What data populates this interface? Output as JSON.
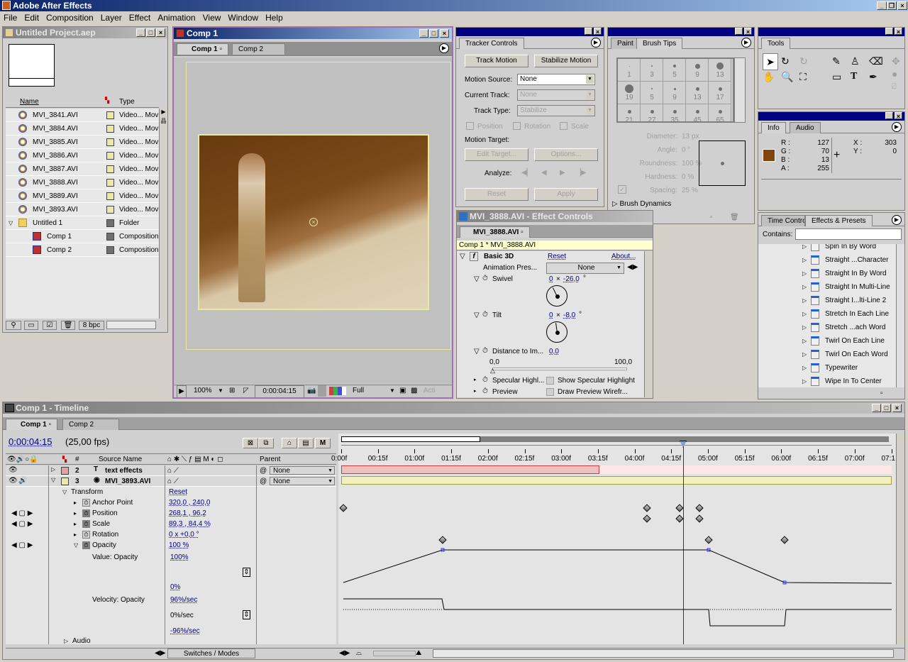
{
  "app": {
    "title": "Adobe After Effects"
  },
  "menu": [
    "File",
    "Edit",
    "Composition",
    "Layer",
    "Effect",
    "Animation",
    "View",
    "Window",
    "Help"
  ],
  "project": {
    "title": "Untitled Project.aep",
    "columns": {
      "name": "Name",
      "type": "Type"
    },
    "items": [
      {
        "name": "MVI_3841.AVI",
        "type": "Video... Movie",
        "label_color": "#ece9a8",
        "indent": 0,
        "icon": "video-file-icon"
      },
      {
        "name": "MVI_3884.AVI",
        "type": "Video... Movie",
        "label_color": "#ece9a8",
        "indent": 0,
        "icon": "video-file-icon"
      },
      {
        "name": "MVI_3885.AVI",
        "type": "Video... Movie",
        "label_color": "#ece9a8",
        "indent": 0,
        "icon": "video-file-icon"
      },
      {
        "name": "MVI_3886.AVI",
        "type": "Video... Movie",
        "label_color": "#ece9a8",
        "indent": 0,
        "icon": "video-file-icon"
      },
      {
        "name": "MVI_3887.AVI",
        "type": "Video... Movie",
        "label_color": "#ece9a8",
        "indent": 0,
        "icon": "video-file-icon"
      },
      {
        "name": "MVI_3888.AVI",
        "type": "Video... Movie",
        "label_color": "#ece9a8",
        "indent": 0,
        "icon": "video-file-icon"
      },
      {
        "name": "MVI_3889.AVI",
        "type": "Video... Movie",
        "label_color": "#ece9a8",
        "indent": 0,
        "icon": "video-file-icon"
      },
      {
        "name": "MVI_3893.AVI",
        "type": "Video... Movie",
        "label_color": "#ece9a8",
        "indent": 0,
        "icon": "video-file-icon"
      },
      {
        "name": "Untitled 1",
        "type": "Folder",
        "label_color": "#707070",
        "indent": 0,
        "icon": "folder-icon",
        "expanded": true
      },
      {
        "name": "Comp 1",
        "type": "Composition",
        "label_color": "#707070",
        "indent": 1,
        "icon": "composition-icon"
      },
      {
        "name": "Comp 2",
        "type": "Composition",
        "label_color": "#707070",
        "indent": 1,
        "icon": "composition-icon"
      }
    ],
    "bpc": "8 bpc"
  },
  "comp_viewer": {
    "title": "Comp 1",
    "tabs": [
      "Comp 1",
      "Comp 2"
    ],
    "zoom": "100%",
    "timecode": "0:00:04:15",
    "resolution": "Full",
    "view": "Acti"
  },
  "tracker": {
    "tab": "Tracker Controls",
    "track_motion": "Track Motion",
    "stabilize_motion": "Stabilize Motion",
    "motion_source_label": "Motion Source:",
    "motion_source": "None",
    "current_track_label": "Current Track:",
    "current_track": "None",
    "track_type_label": "Track Type:",
    "track_type": "Stabilize",
    "position": "Position",
    "rotation": "Rotation",
    "scale": "Scale",
    "motion_target_label": "Motion Target:",
    "edit_target": "Edit Target...",
    "options": "Options...",
    "analyze_label": "Analyze:",
    "reset": "Reset",
    "apply": "Apply"
  },
  "brush": {
    "tabs": [
      "Paint",
      "Brush Tips"
    ],
    "tips": [
      "1",
      "3",
      "5",
      "9",
      "13",
      "19",
      "5",
      "9",
      "13",
      "17",
      "21",
      "27",
      "35",
      "45",
      "65"
    ],
    "diameter_label": "Diameter:",
    "diameter": "13 px",
    "angle_label": "Angle:",
    "angle": "0 °",
    "roundness_label": "Roundness:",
    "roundness": "100 %",
    "hardness_label": "Hardness:",
    "hardness": "0 %",
    "spacing_label": "Spacing:",
    "spacing": "25 %",
    "dynamics": "Brush Dynamics"
  },
  "tools": {
    "tab": "Tools"
  },
  "info": {
    "tabs": [
      "Info",
      "Audio"
    ],
    "r_label": "R :",
    "r": "127",
    "g_label": "G :",
    "g": "70",
    "b_label": "B :",
    "b": "13",
    "a_label": "A :",
    "a": "255",
    "x_label": "X :",
    "x": "303",
    "y_label": "Y :",
    "y": "0",
    "swatch": "#7f460d"
  },
  "effects_presets": {
    "tabs": [
      "Time Contro",
      "Effects & Presets"
    ],
    "contains_label": "Contains:",
    "contains_value": "",
    "items": [
      "Spin In By Word",
      "Straight ...Character",
      "Straight In By Word",
      "Straight In Multi-Line",
      "Straight I...lti-Line 2",
      "Stretch In Each Line",
      "Stretch ...ach Word",
      "Twirl On Each Line",
      "Twirl On Each Word",
      "Typewriter",
      "Wipe In To Center"
    ]
  },
  "effect_controls": {
    "title": "MVI_3888.AVI - Effect Controls",
    "tab": "MVI_3888.AVI",
    "breadcrumb": "Comp 1 * MVI_3888.AVI",
    "effect_name": "Basic 3D",
    "reset": "Reset",
    "about": "About...",
    "anim_preset_label": "Animation Pres...",
    "anim_preset": "None",
    "swivel_label": "Swivel",
    "swivel_rev": "0",
    "swivel_deg": "-26,0",
    "tilt_label": "Tilt",
    "tilt_rev": "0",
    "tilt_deg": "-8,0",
    "distance_label": "Distance to Im...",
    "distance": "0,0",
    "slider_min": "0,0",
    "slider_max": "100,0",
    "specular_label": "Specular Highl...",
    "specular_cb": "Show Specular Highlight",
    "preview_label": "Preview",
    "preview_cb": "Draw Preview Wirefr..."
  },
  "timeline": {
    "title": "Comp 1 - Timeline",
    "tabs": [
      "Comp 1",
      "Comp 2"
    ],
    "timecode": "0:00:04:15",
    "fps": "(25,00 fps)",
    "col_num": "#",
    "col_source": "Source Name",
    "col_parent": "Parent",
    "ruler": [
      "0:00f",
      "00:15f",
      "01:00f",
      "01:15f",
      "02:00f",
      "02:15f",
      "03:00f",
      "03:15f",
      "04:00f",
      "04:15f",
      "05:00f",
      "05:15f",
      "06:00f",
      "06:15f",
      "07:00f",
      "07:1"
    ],
    "layers": [
      {
        "num": "2",
        "name": "text effects",
        "label_color": "#e8a0a0",
        "parent": "None",
        "icon": "text-layer-icon"
      },
      {
        "num": "3",
        "name": "MVI_3893.AVI",
        "label_color": "#ece9a8",
        "parent": "None",
        "icon": "video-file-icon"
      }
    ],
    "transform_label": "Transform",
    "transform_reset": "Reset",
    "props": [
      {
        "name": "Anchor Point",
        "value": "320,0 , 240,0"
      },
      {
        "name": "Position",
        "value": "268,1 , 96,2"
      },
      {
        "name": "Scale",
        "value": "89,3 , 84,4 %"
      },
      {
        "name": "Rotation",
        "value": "0 x +0,0 °"
      },
      {
        "name": "Opacity",
        "value": "100 %"
      }
    ],
    "value_opacity_label": "Value: Opacity",
    "value_opacity": "100%",
    "value_min": "0%",
    "velocity_label": "Velocity: Opacity",
    "velocity_max": "96%/sec",
    "velocity_mid": "0%/sec",
    "velocity_min": "-96%/sec",
    "audio_label": "Audio",
    "switches_modes": "Switches / Modes",
    "current_time_fraction": 0.618
  }
}
